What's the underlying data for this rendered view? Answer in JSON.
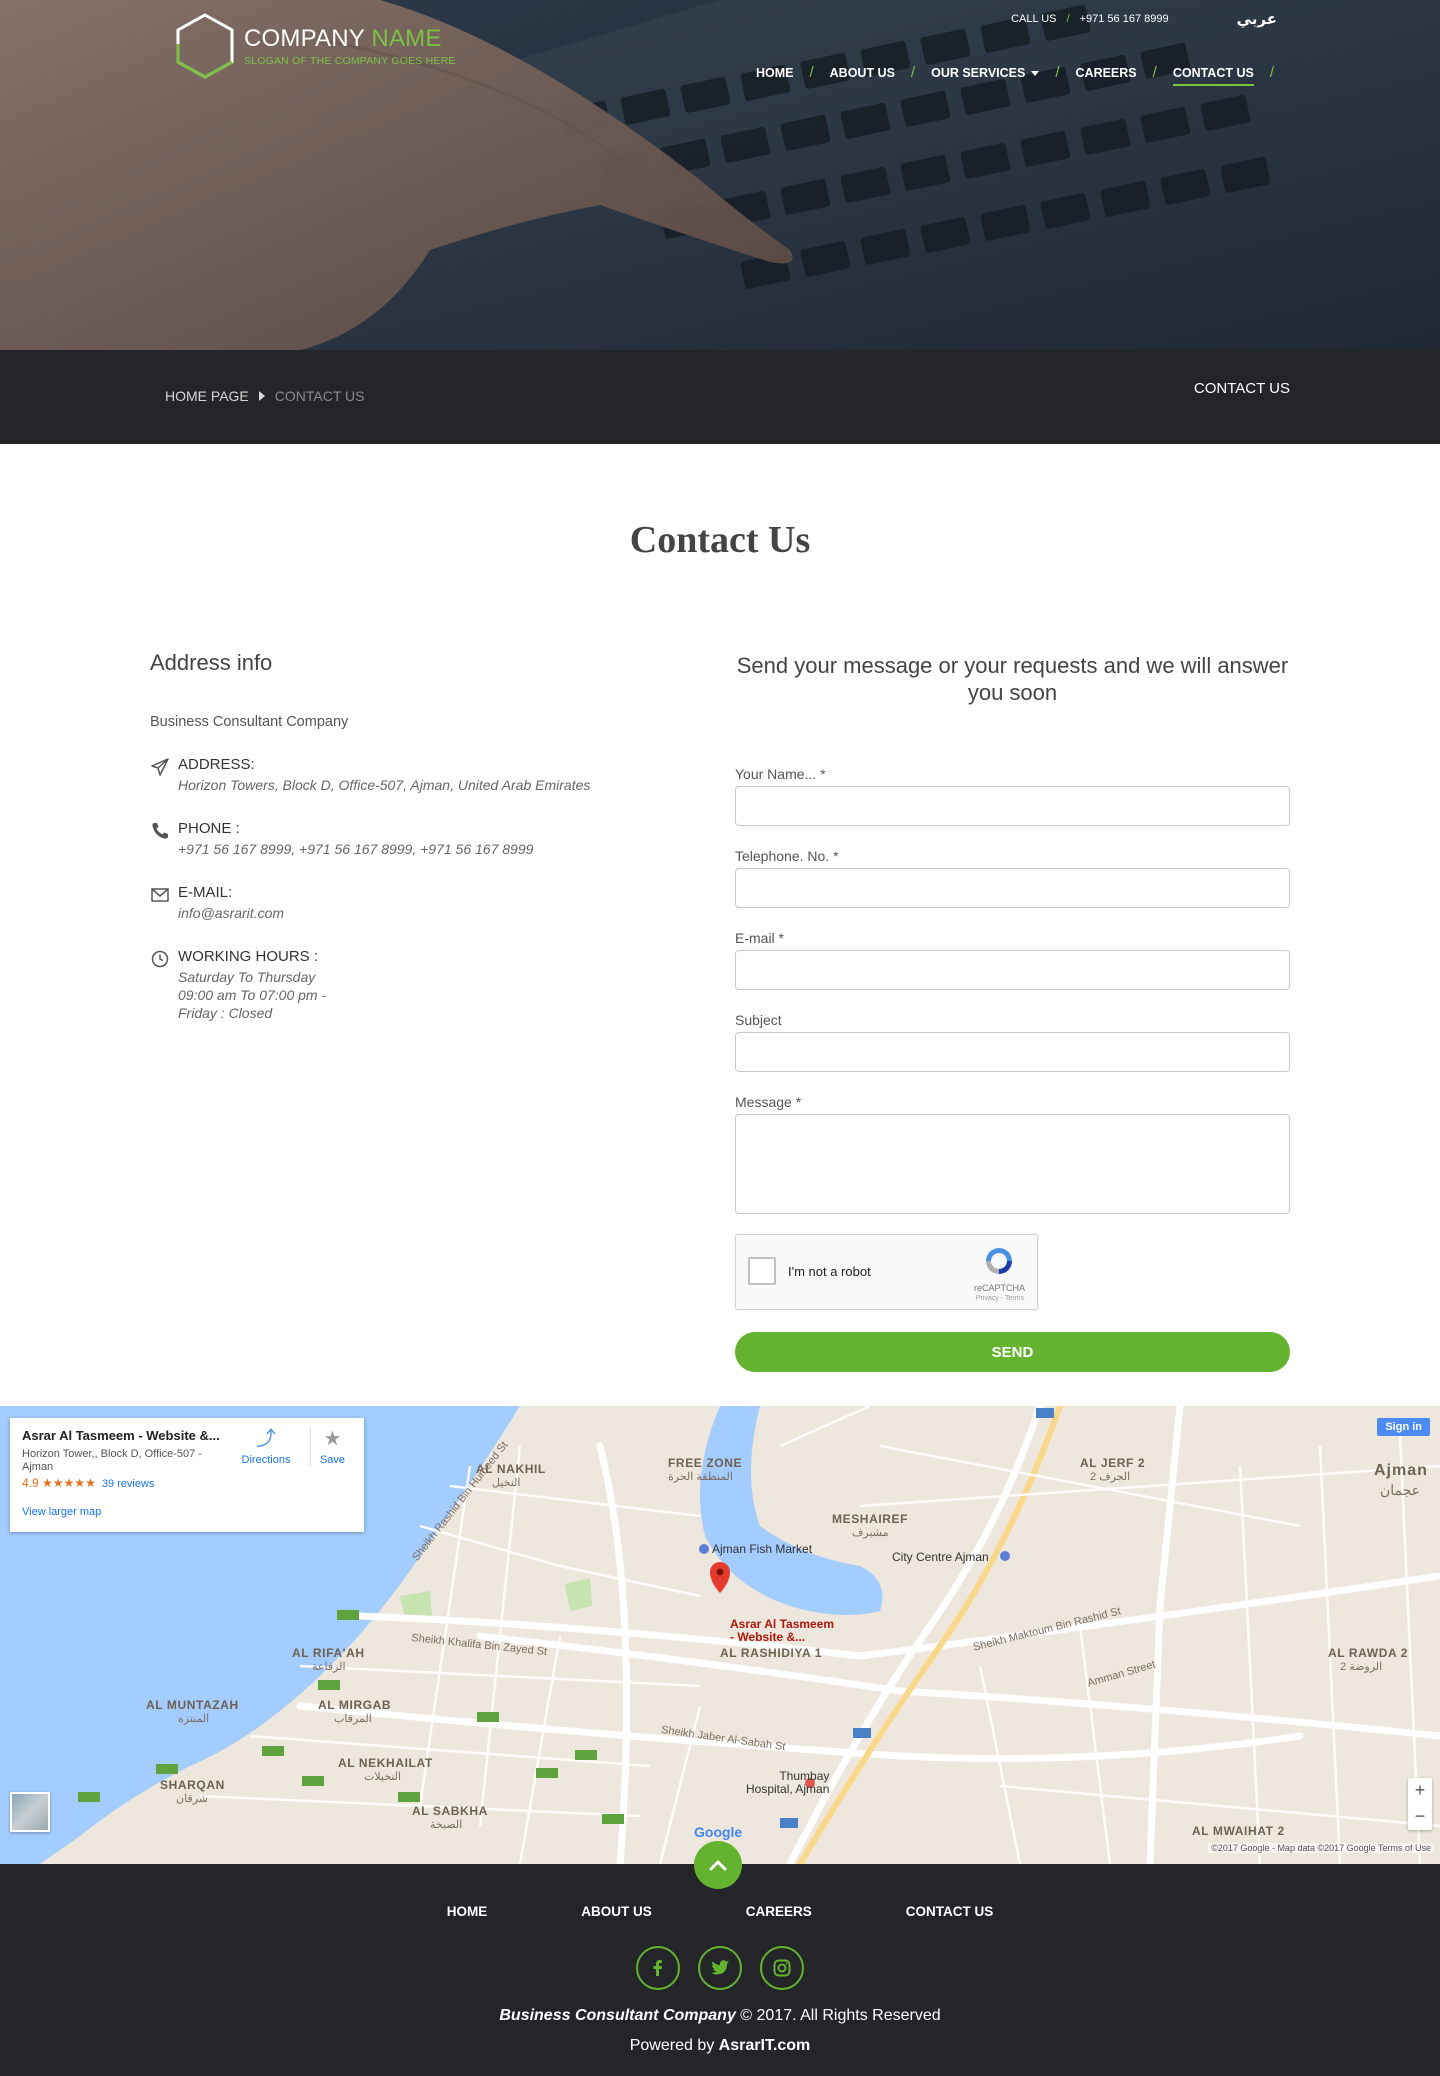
{
  "brand": {
    "name_part1": "COMPANY ",
    "name_part2": "NAME",
    "slogan": "SLOGAN OF THE COMPANY GOES HERE",
    "accent_color": "#7cc242"
  },
  "topbar": {
    "call_label": "CALL US",
    "phone": "+971 56 167 8999",
    "language": "عربي"
  },
  "nav": {
    "items": [
      {
        "label": "HOME"
      },
      {
        "label": "ABOUT US"
      },
      {
        "label": "OUR SERVICES"
      },
      {
        "label": "CAREERS"
      },
      {
        "label": "CONTACT US"
      }
    ],
    "active": "CONTACT US"
  },
  "breadcrumb": {
    "home": "HOME PAGE",
    "current": "CONTACT US",
    "title": "CONTACT US"
  },
  "page": {
    "title": "Contact Us"
  },
  "address": {
    "heading": "Address info",
    "company": "Business Consultant Company",
    "rows": [
      {
        "icon": "paper-plane-icon",
        "label": "ADDRESS:",
        "value": "Horizon Towers, Block D, Office-507, Ajman, United Arab Emirates"
      },
      {
        "icon": "phone-icon",
        "label": "PHONE :",
        "value": "+971 56 167 8999, +971 56 167 8999, +971 56 167 8999"
      },
      {
        "icon": "envelope-icon",
        "label": "E-MAIL:",
        "value": "info@asrarit.com"
      },
      {
        "icon": "clock-icon",
        "label": "WORKING HOURS :",
        "value": "Saturday To Thursday\n09:00 am To 07:00 pm -\nFriday : Closed"
      }
    ]
  },
  "form": {
    "heading": "Send your message or your requests and we will answer you soon",
    "fields": {
      "name": {
        "label": "Your Name... *",
        "value": ""
      },
      "phone": {
        "label": "Telephone. No. *",
        "value": ""
      },
      "email": {
        "label": "E-mail *",
        "value": ""
      },
      "subject": {
        "label": "Subject",
        "value": ""
      },
      "message": {
        "label": "Message *",
        "value": ""
      }
    },
    "captcha": {
      "label": "I'm not a robot",
      "brand": "reCAPTCHA",
      "links": "Privacy - Terms"
    },
    "submit": "SEND",
    "button_color": "#64b32e"
  },
  "map": {
    "card": {
      "title": "Asrar Al Tasmeem - Website &...",
      "address": "Horizon Tower,, Block D, Office-507 - Ajman",
      "rating": "4.9",
      "stars": "★★★★★",
      "reviews": "39 reviews",
      "link": "View larger map",
      "directions": "Directions",
      "save": "Save"
    },
    "signin": "Sign in",
    "zoom_in": "+",
    "zoom_out": "−",
    "google": "Google",
    "copyright": "©2017 Google - Map data ©2017 Google    Terms of Use",
    "labels": {
      "al_nakhil": "AL NAKHIL",
      "al_nakhil_ar": "النخيل",
      "free_zone": "FREE ZONE",
      "free_zone_ar": "المنطقة الحرة",
      "al_jerf": "AL JERF 2",
      "al_jerf_ar": "2 الجرف",
      "ajman": "Ajman",
      "ajman_ar": "عجمان",
      "meshairef": "MESHAIREF",
      "meshairef_ar": "مشيرف",
      "al_rashidiya": "AL RASHIDIYA 1",
      "al_rifaah": "AL RIFA'AH",
      "al_rifaah_ar": "الرفاعة",
      "al_muntazah": "AL MUNTAZAH",
      "al_muntazah_ar": "المنتزه",
      "al_mirgab": "AL MIRGAB",
      "al_mirgab_ar": "المرقاب",
      "al_nekhailat": "AL NEKHAILAT",
      "al_nekhailat_ar": "النخيلات",
      "sharqan": "SHARQAN",
      "sharqan_ar": "شرقان",
      "al_sabkha": "AL SABKHA",
      "al_sabkha_ar": "الصبخة",
      "al_rawda": "AL RAWDA 2",
      "al_rawda_ar": "2 الروضة",
      "al_mwaihat": "AL MWAIHAT 2",
      "street_rashid": "Sheikh Rashid Bin Humeed St",
      "street_khalifa": "Sheikh Khalifa Bin Zayed St",
      "street_maktoum": "Sheikh Maktoum Bin Rashid St",
      "street_amman": "Amman Street",
      "street_jaber": "Sheikh Jaber Al-Sabah St"
    },
    "pois": {
      "fish_market": "Ajman Fish Market",
      "city_centre": "City Centre Ajman",
      "pin": "Asrar Al Tasmeem\n- Website &...",
      "thumbay": "Thumbay\nHospital, Ajman"
    }
  },
  "footer": {
    "nav": [
      "HOME",
      "ABOUT US",
      "CAREERS",
      "CONTACT US"
    ],
    "company": "Business Consultant Company",
    "copyright_suffix": " © 2017. All Rights Reserved",
    "powered_prefix": "Powered by ",
    "powered_by": "AsrarIT.com",
    "socials": [
      "facebook-icon",
      "twitter-icon",
      "instagram-icon"
    ]
  }
}
